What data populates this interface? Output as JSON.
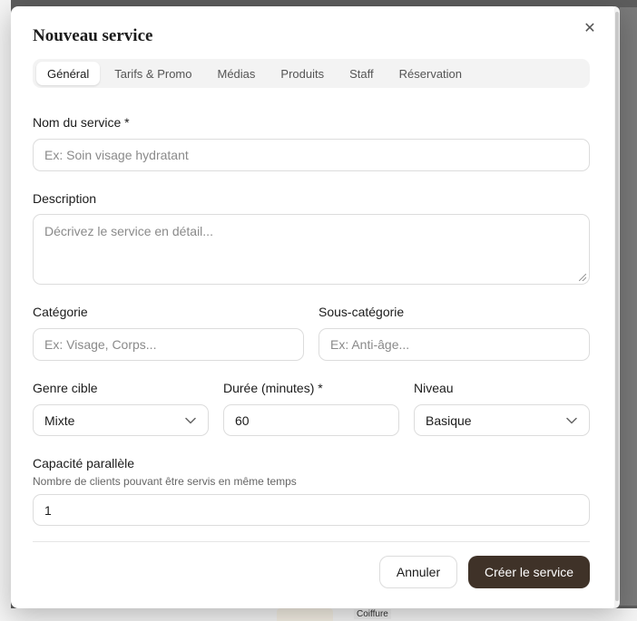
{
  "modal": {
    "title": "Nouveau service",
    "close_glyph": "✕"
  },
  "tabs": [
    {
      "label": "Général",
      "active": true
    },
    {
      "label": "Tarifs & Promo",
      "active": false
    },
    {
      "label": "Médias",
      "active": false
    },
    {
      "label": "Produits",
      "active": false
    },
    {
      "label": "Staff",
      "active": false
    },
    {
      "label": "Réservation",
      "active": false
    }
  ],
  "form": {
    "service_name": {
      "label": "Nom du service *",
      "placeholder": "Ex: Soin visage hydratant",
      "value": ""
    },
    "description": {
      "label": "Description",
      "placeholder": "Décrivez le service en détail...",
      "value": ""
    },
    "category": {
      "label": "Catégorie",
      "placeholder": "Ex: Visage, Corps...",
      "value": ""
    },
    "subcategory": {
      "label": "Sous-catégorie",
      "placeholder": "Ex: Anti-âge...",
      "value": ""
    },
    "target_gender": {
      "label": "Genre cible",
      "value": "Mixte"
    },
    "duration": {
      "label": "Durée (minutes) *",
      "value": "60"
    },
    "level": {
      "label": "Niveau",
      "value": "Basique"
    },
    "parallel_capacity": {
      "label": "Capacité parallèle",
      "help": "Nombre de clients pouvant être servis en même temps",
      "value": "1"
    }
  },
  "actions": {
    "cancel_label": "Annuler",
    "create_label": "Créer le service"
  },
  "background": {
    "bottom_label": "Coiffure"
  },
  "colors": {
    "primary_button": "#3f3228",
    "border": "#dcdcdc",
    "tab_bar": "#f3f3f3"
  },
  "icons": {
    "close": "close-icon",
    "select_arrow": "chevron-down-icon"
  }
}
